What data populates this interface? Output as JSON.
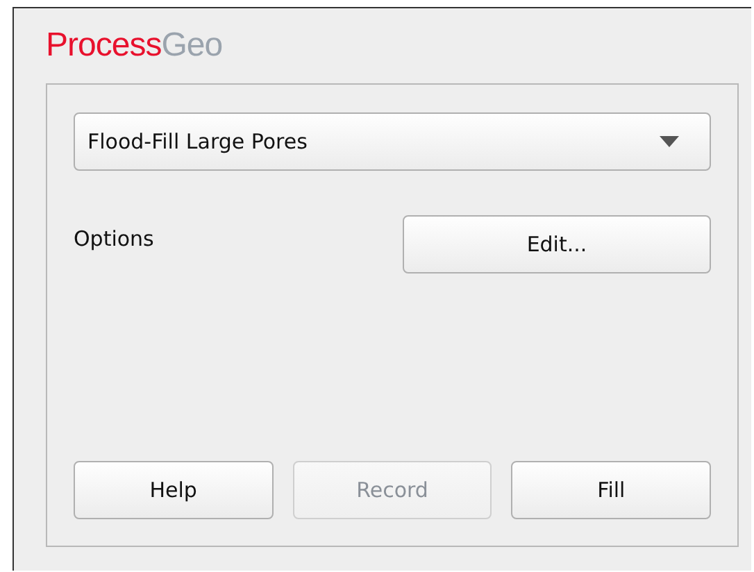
{
  "title": {
    "brand": "Process",
    "suffix": "Geo"
  },
  "method": {
    "value": "Flood-Fill Large Pores"
  },
  "options": {
    "label": "Options",
    "button": "Edit..."
  },
  "buttons": [
    {
      "label": "Help",
      "disabled": false
    },
    {
      "label": "Record",
      "disabled": true
    },
    {
      "label": "Fill",
      "disabled": false
    }
  ]
}
